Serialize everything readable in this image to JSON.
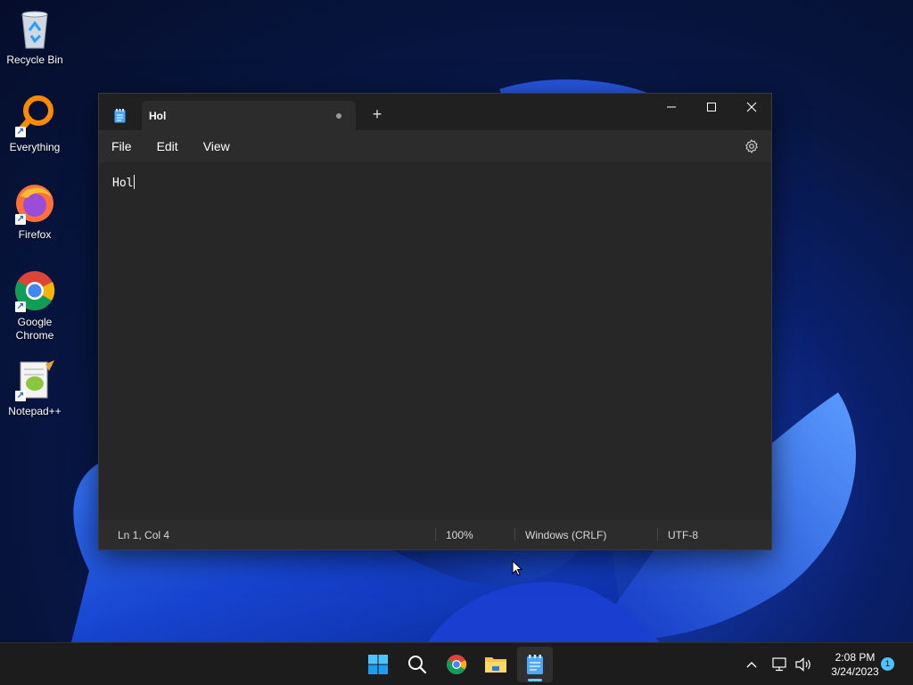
{
  "desktop": {
    "icons": [
      {
        "label": "Recycle Bin"
      },
      {
        "label": "Everything"
      },
      {
        "label": "Firefox"
      },
      {
        "label": "Google Chrome"
      },
      {
        "label": "Notepad++"
      }
    ]
  },
  "window": {
    "tab_title": "Hol",
    "new_tab_glyph": "+",
    "menu": [
      "File",
      "Edit",
      "View"
    ],
    "content": "Hol",
    "status": {
      "position": "Ln 1, Col 4",
      "zoom": "100%",
      "line_ending": "Windows (CRLF)",
      "encoding": "UTF-8"
    }
  },
  "taskbar": {
    "apps": [
      {
        "icon": "windows-start-icon"
      },
      {
        "icon": "search-icon"
      },
      {
        "icon": "chrome-icon"
      },
      {
        "icon": "file-explorer-icon"
      },
      {
        "icon": "notepad-icon",
        "active": true
      }
    ],
    "time": "2:08 PM",
    "date": "3/24/2023",
    "notification_count": "1"
  },
  "colors": {
    "accent": "#60cdff",
    "window_bg": "#272727",
    "titlebar_bg": "#202020"
  }
}
